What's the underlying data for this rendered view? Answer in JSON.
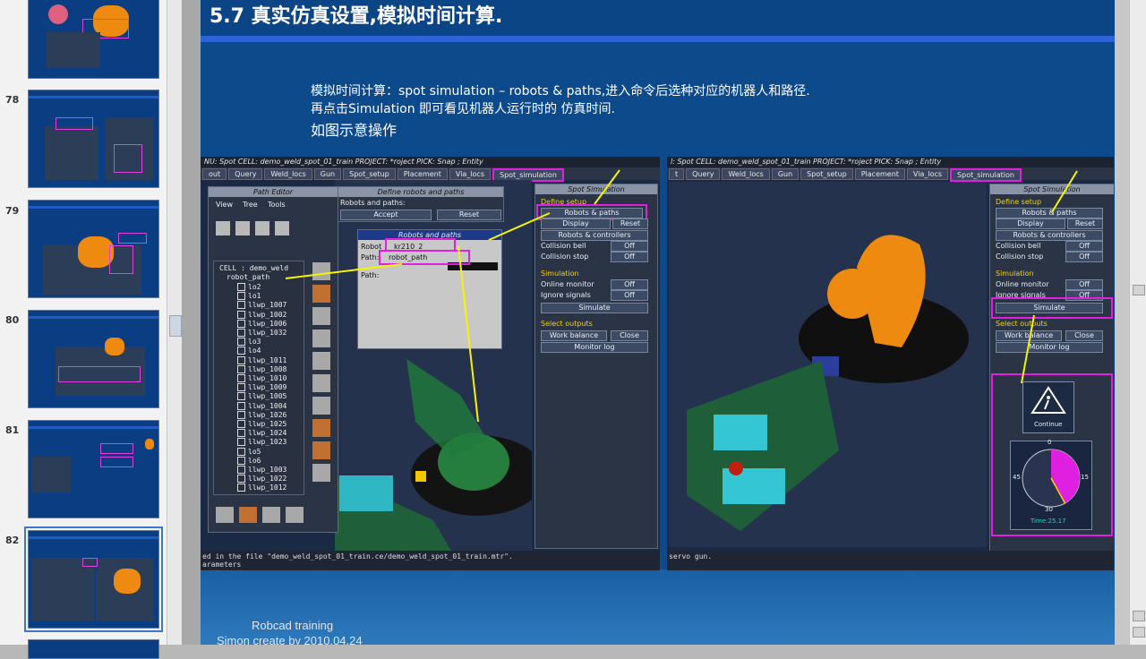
{
  "thumbnails": {
    "numbers": [
      "78",
      "79",
      "80",
      "81",
      "82"
    ]
  },
  "slide": {
    "title": "5.7 真实仿真设置,模拟时间计算.",
    "lines": [
      "模拟时间计算：spot simulation – robots & paths,进入命令后选种对应的机器人和路径.",
      "再点击Simulation 即可看见机器人运行时的   仿真时间.",
      "如图示意操作"
    ],
    "footer_line1": "Robcad training",
    "footer_line2": "Simon create by 2010.04.24"
  },
  "left_shot": {
    "menu_bar": "NU: Spot    CELL: demo_weld_spot_01_train    PROJECT: *roject        PICK: Snap ; Entity",
    "tabs": [
      "out",
      "Query",
      "Weld_locs",
      "Gun",
      "Spot_setup",
      "Placement",
      "Via_locs",
      "Spot_simulation"
    ],
    "path_editor": {
      "title": "Path Editor",
      "menu": [
        "View",
        "Tree",
        "Tools"
      ],
      "tree_root": "CELL : demo_weld",
      "tree_path": "robot_path",
      "tree_items": [
        "lo2",
        "lo1",
        "llwp_1007",
        "llwp_1002",
        "llwp_1006",
        "llwp_1032",
        "lo3",
        "lo4",
        "llwp_1011",
        "llwp_1008",
        "llwp_1010",
        "llwp_1009",
        "llwp_1005",
        "llwp_1004",
        "llwp_1026",
        "llwp_1025",
        "llwp_1024",
        "llwp_1023",
        "lo5",
        "lo6",
        "llwp_1003",
        "llwp_1022",
        "llwp_1012"
      ]
    },
    "define_robots": {
      "title": "Define robots and paths",
      "label": "Robots and paths:",
      "accept": "Accept",
      "reset": "Reset"
    },
    "robots_and_paths": {
      "title": "Robots and paths",
      "robot_label": "Robot",
      "robot_value": "kr210_2",
      "path_label": "Path:",
      "path_value": "robot_path",
      "path2_label": "Path:"
    },
    "spot_sim": {
      "title": "Spot Simulation",
      "define_setup": "Define setup",
      "robots_paths": "Robots & paths",
      "display": "Display",
      "reset": "Reset",
      "robots_controllers": "Robots & controllers",
      "collision_bell": "Collision bell",
      "collision_stop": "Collision stop",
      "off": "Off",
      "simulation": "Simulation",
      "online_monitor": "Online monitor",
      "ignore_signals": "Ignore signals",
      "simulate": "Simulate",
      "select_outputs": "Select outputs",
      "work_balance": "Work balance",
      "close": "Close",
      "monitor_log": "Monitor log"
    },
    "status_line1": "ed in the file \"demo_weld_spot_01_train.ce/demo_weld_spot_01_train.mtr\".",
    "status_line2": "arameters"
  },
  "right_shot": {
    "menu_bar": "l: Spot    CELL: demo_weld_spot_01_train    PROJECT: *roject        PICK: Snap ; Entity",
    "tabs": [
      "t",
      "Query",
      "Weld_locs",
      "Gun",
      "Spot_setup",
      "Placement",
      "Via_locs",
      "Spot_simulation"
    ],
    "spot_sim": {
      "title": "Spot Simulation",
      "define_setup": "Define setup",
      "robots_paths": "Robots & paths",
      "display": "Display",
      "reset": "Reset",
      "robots_controllers": "Robots & controllers",
      "collision_bell": "Collision bell",
      "collision_stop": "Collision stop",
      "off": "Off",
      "simulation": "Simulation",
      "online_monitor": "Online monitor",
      "ignore_signals": "Ignore signals",
      "simulate": "Simulate",
      "select_outputs": "Select outputs",
      "work_balance": "Work balance",
      "close": "Close",
      "monitor_log": "Monitor log"
    },
    "continue_label": "Continue",
    "clock": {
      "top": "0",
      "right": "15",
      "bottom": "30",
      "left": "45",
      "time": "Time:25.17",
      "seconds_elapsed": 25.17
    },
    "status_line1": "servo gun."
  },
  "colors": {
    "slide_blue": "#0d4a8c",
    "accent_bar": "#2d63d8",
    "highlight": "#e020e0",
    "arrow": "#f5f500",
    "robot_orange": "#ef8a10"
  }
}
